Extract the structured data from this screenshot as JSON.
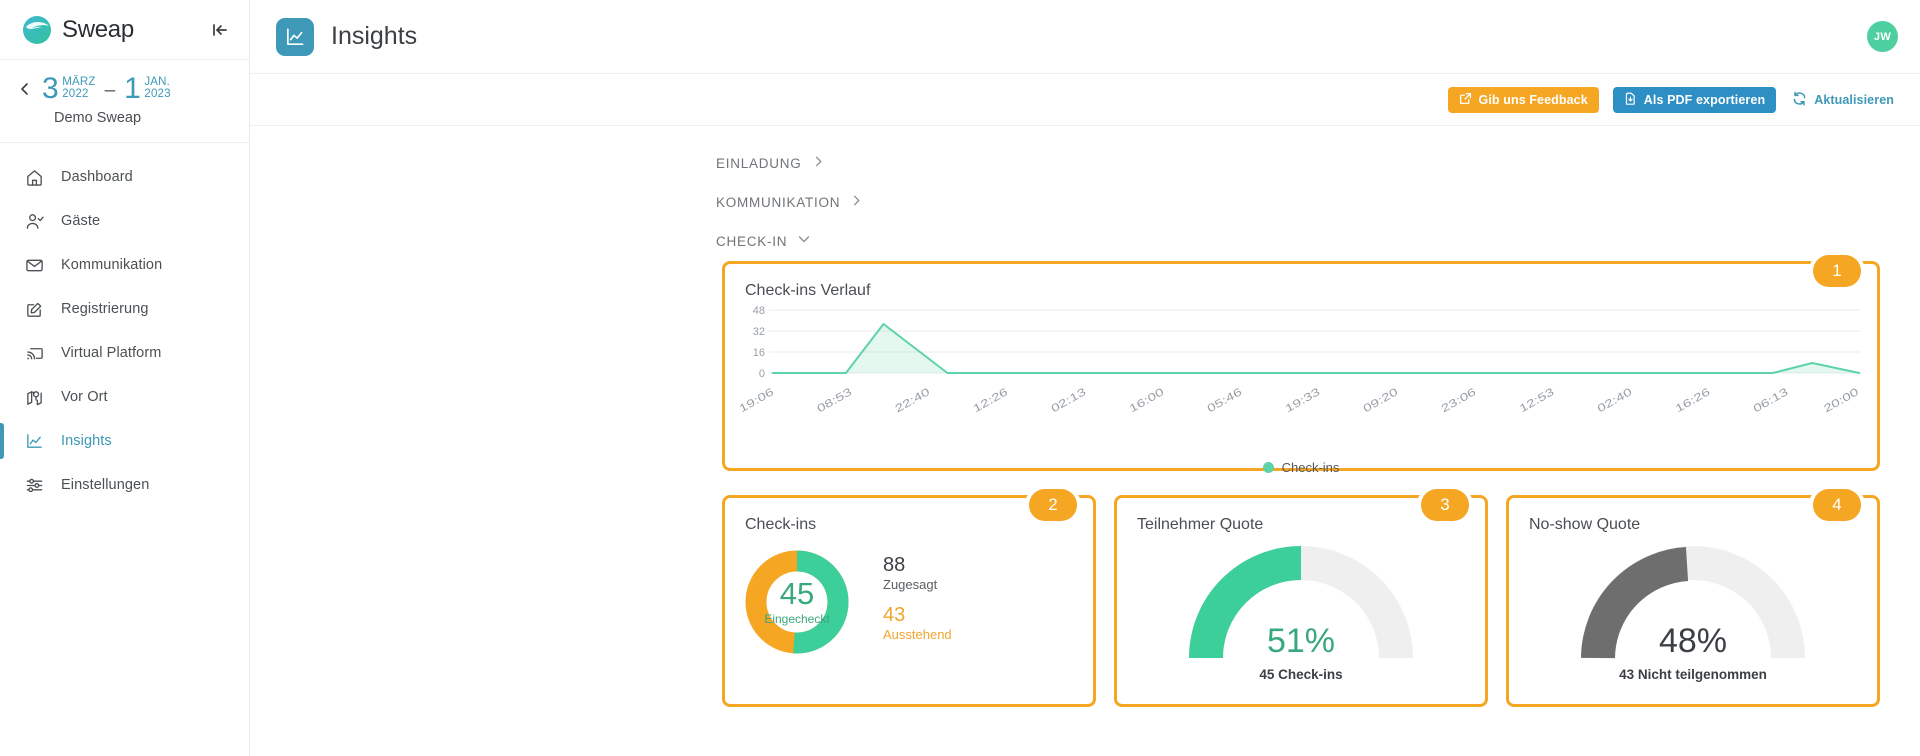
{
  "brand": {
    "name": "Sweap",
    "collapse_icon": "collapse-left-icon"
  },
  "event": {
    "back_icon": "chevron-left-icon",
    "start_day": "3",
    "start_month": "MÄRZ",
    "start_year": "2022",
    "dash": "–",
    "end_day": "1",
    "end_month": "JAN.",
    "end_year": "2023",
    "name": "Demo Sweap"
  },
  "sidebar": {
    "items": [
      {
        "label": "Dashboard",
        "icon": "home-icon",
        "active": false
      },
      {
        "label": "Gäste",
        "icon": "user-check-icon",
        "active": false
      },
      {
        "label": "Kommunikation",
        "icon": "mail-icon",
        "active": false
      },
      {
        "label": "Registrierung",
        "icon": "form-edit-icon",
        "active": false
      },
      {
        "label": "Virtual Platform",
        "icon": "cast-icon",
        "active": false
      },
      {
        "label": "Vor Ort",
        "icon": "map-pin-icon",
        "active": false
      },
      {
        "label": "Insights",
        "icon": "chart-line-icon",
        "active": true
      },
      {
        "label": "Einstellungen",
        "icon": "sliders-icon",
        "active": false
      }
    ]
  },
  "header": {
    "title": "Insights",
    "icon": "chart-line-icon",
    "avatar_initials": "JW"
  },
  "toolbar": {
    "feedback_label": "Gib uns Feedback",
    "feedback_icon": "external-link-icon",
    "pdf_label": "Als PDF exportieren",
    "pdf_icon": "file-download-icon",
    "refresh_label": "Aktualisieren",
    "refresh_icon": "refresh-icon"
  },
  "colors": {
    "accent_blue": "#3e98b8",
    "orange": "#f5a623",
    "green": "#3dcf9a",
    "green_dark": "#3aa87d",
    "gray_track": "#efefef",
    "gray_dark": "#6e6e6e"
  },
  "sections": [
    {
      "label": "EINLADUNG",
      "state": "collapsed",
      "icon": "chevron-right-icon"
    },
    {
      "label": "KOMMUNIKATION",
      "state": "collapsed",
      "icon": "chevron-right-icon"
    },
    {
      "label": "CHECK-IN",
      "state": "expanded",
      "icon": "chevron-down-icon"
    }
  ],
  "cards": {
    "timeline": {
      "title": "Check-ins Verlauf",
      "badge": "1"
    },
    "checkins": {
      "title": "Check-ins",
      "badge": "2"
    },
    "attendance": {
      "title": "Teilnehmer Quote",
      "badge": "3"
    },
    "noshow": {
      "title": "No-show Quote",
      "badge": "4"
    }
  },
  "checkins_donut": {
    "center_value": "45",
    "center_caption": "Eingecheckt",
    "confirmed_value": "88",
    "confirmed_label": "Zugesagt",
    "pending_value": "43",
    "pending_label": "Ausstehend"
  },
  "attendance_gauge": {
    "percent": "51%",
    "percent_num": 51,
    "sub": "45 Check-ins"
  },
  "noshow_gauge": {
    "percent": "48%",
    "percent_num": 48,
    "sub": "43 Nicht teilgenommen"
  },
  "chart_data": {
    "type": "area",
    "title": "Check-ins Verlauf",
    "xlabel": "",
    "ylabel": "",
    "ylim": [
      0,
      48
    ],
    "yticks": [
      0,
      16,
      32,
      48
    ],
    "grid": true,
    "legend_position": "bottom",
    "legend": [
      "Check-ins"
    ],
    "series": [
      {
        "name": "Check-ins",
        "color": "#5fd3a8",
        "x": [
          "19:06",
          "08:53",
          "22:40",
          "12:26",
          "02:13",
          "16:00",
          "05:46",
          "19:33",
          "09:20",
          "23:06",
          "12:53",
          "02:40",
          "16:26",
          "06:13",
          "20:00"
        ],
        "values": [
          0,
          0,
          0,
          0,
          0,
          0,
          0,
          0,
          0,
          0,
          0,
          0,
          0,
          0,
          4
        ]
      }
    ],
    "xticks": [
      "19:06",
      "08:53",
      "22:40",
      "12:26",
      "02:13",
      "16:00",
      "05:46",
      "19:33",
      "09:20",
      "23:06",
      "12:53",
      "02:40",
      "16:26",
      "06:13",
      "20:00"
    ],
    "peak_value": 37,
    "peak_between": [
      "19:06",
      "08:53"
    ],
    "notes": "Flat at 0 across most of range; one sharp peak ~37 shortly before 08:53 returning to 0 before 22:40; small bump ~4 near 20:00 at the right end."
  }
}
